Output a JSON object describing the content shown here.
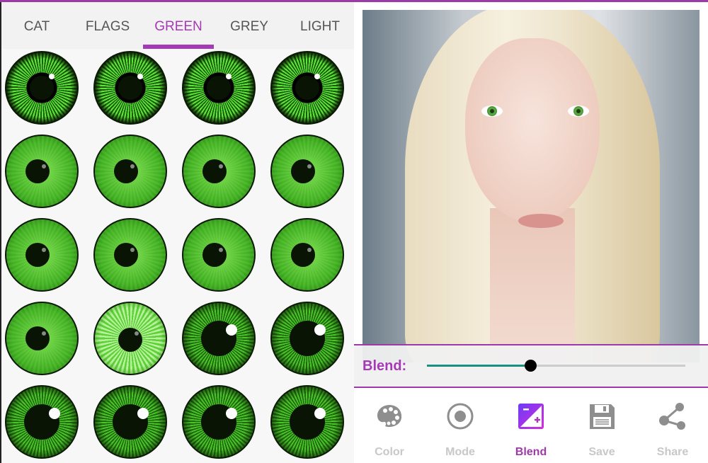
{
  "tabs": [
    {
      "label": "CAT"
    },
    {
      "label": "FLAGS"
    },
    {
      "label": "GREEN",
      "active": true
    },
    {
      "label": "GREY"
    },
    {
      "label": "LIGHT"
    }
  ],
  "eyes": [
    [
      "dark-fiber",
      "dark-fiber",
      "dark-fiber",
      "dark-fiber"
    ],
    [
      "bright",
      "bright",
      "bright",
      "bright"
    ],
    [
      "bright",
      "bright",
      "bright",
      "bright"
    ],
    [
      "bright",
      "light",
      "dark-highlight",
      "dark-highlight"
    ],
    [
      "dark-highlight",
      "dark-highlight",
      "dark-highlight",
      "dark-highlight"
    ]
  ],
  "blend": {
    "label": "Blend:",
    "value_percent": 40
  },
  "nav": [
    {
      "label": "Color",
      "icon": "palette-icon"
    },
    {
      "label": "Mode",
      "icon": "radio-button-icon"
    },
    {
      "label": "Blend",
      "icon": "blend-icon",
      "active": true
    },
    {
      "label": "Save",
      "icon": "floppy-disk-icon"
    },
    {
      "label": "Share",
      "icon": "share-icon"
    }
  ],
  "colors": {
    "accent": "#a53ab5",
    "slider": "#1d8f80",
    "inactive": "#c8c8c8"
  }
}
